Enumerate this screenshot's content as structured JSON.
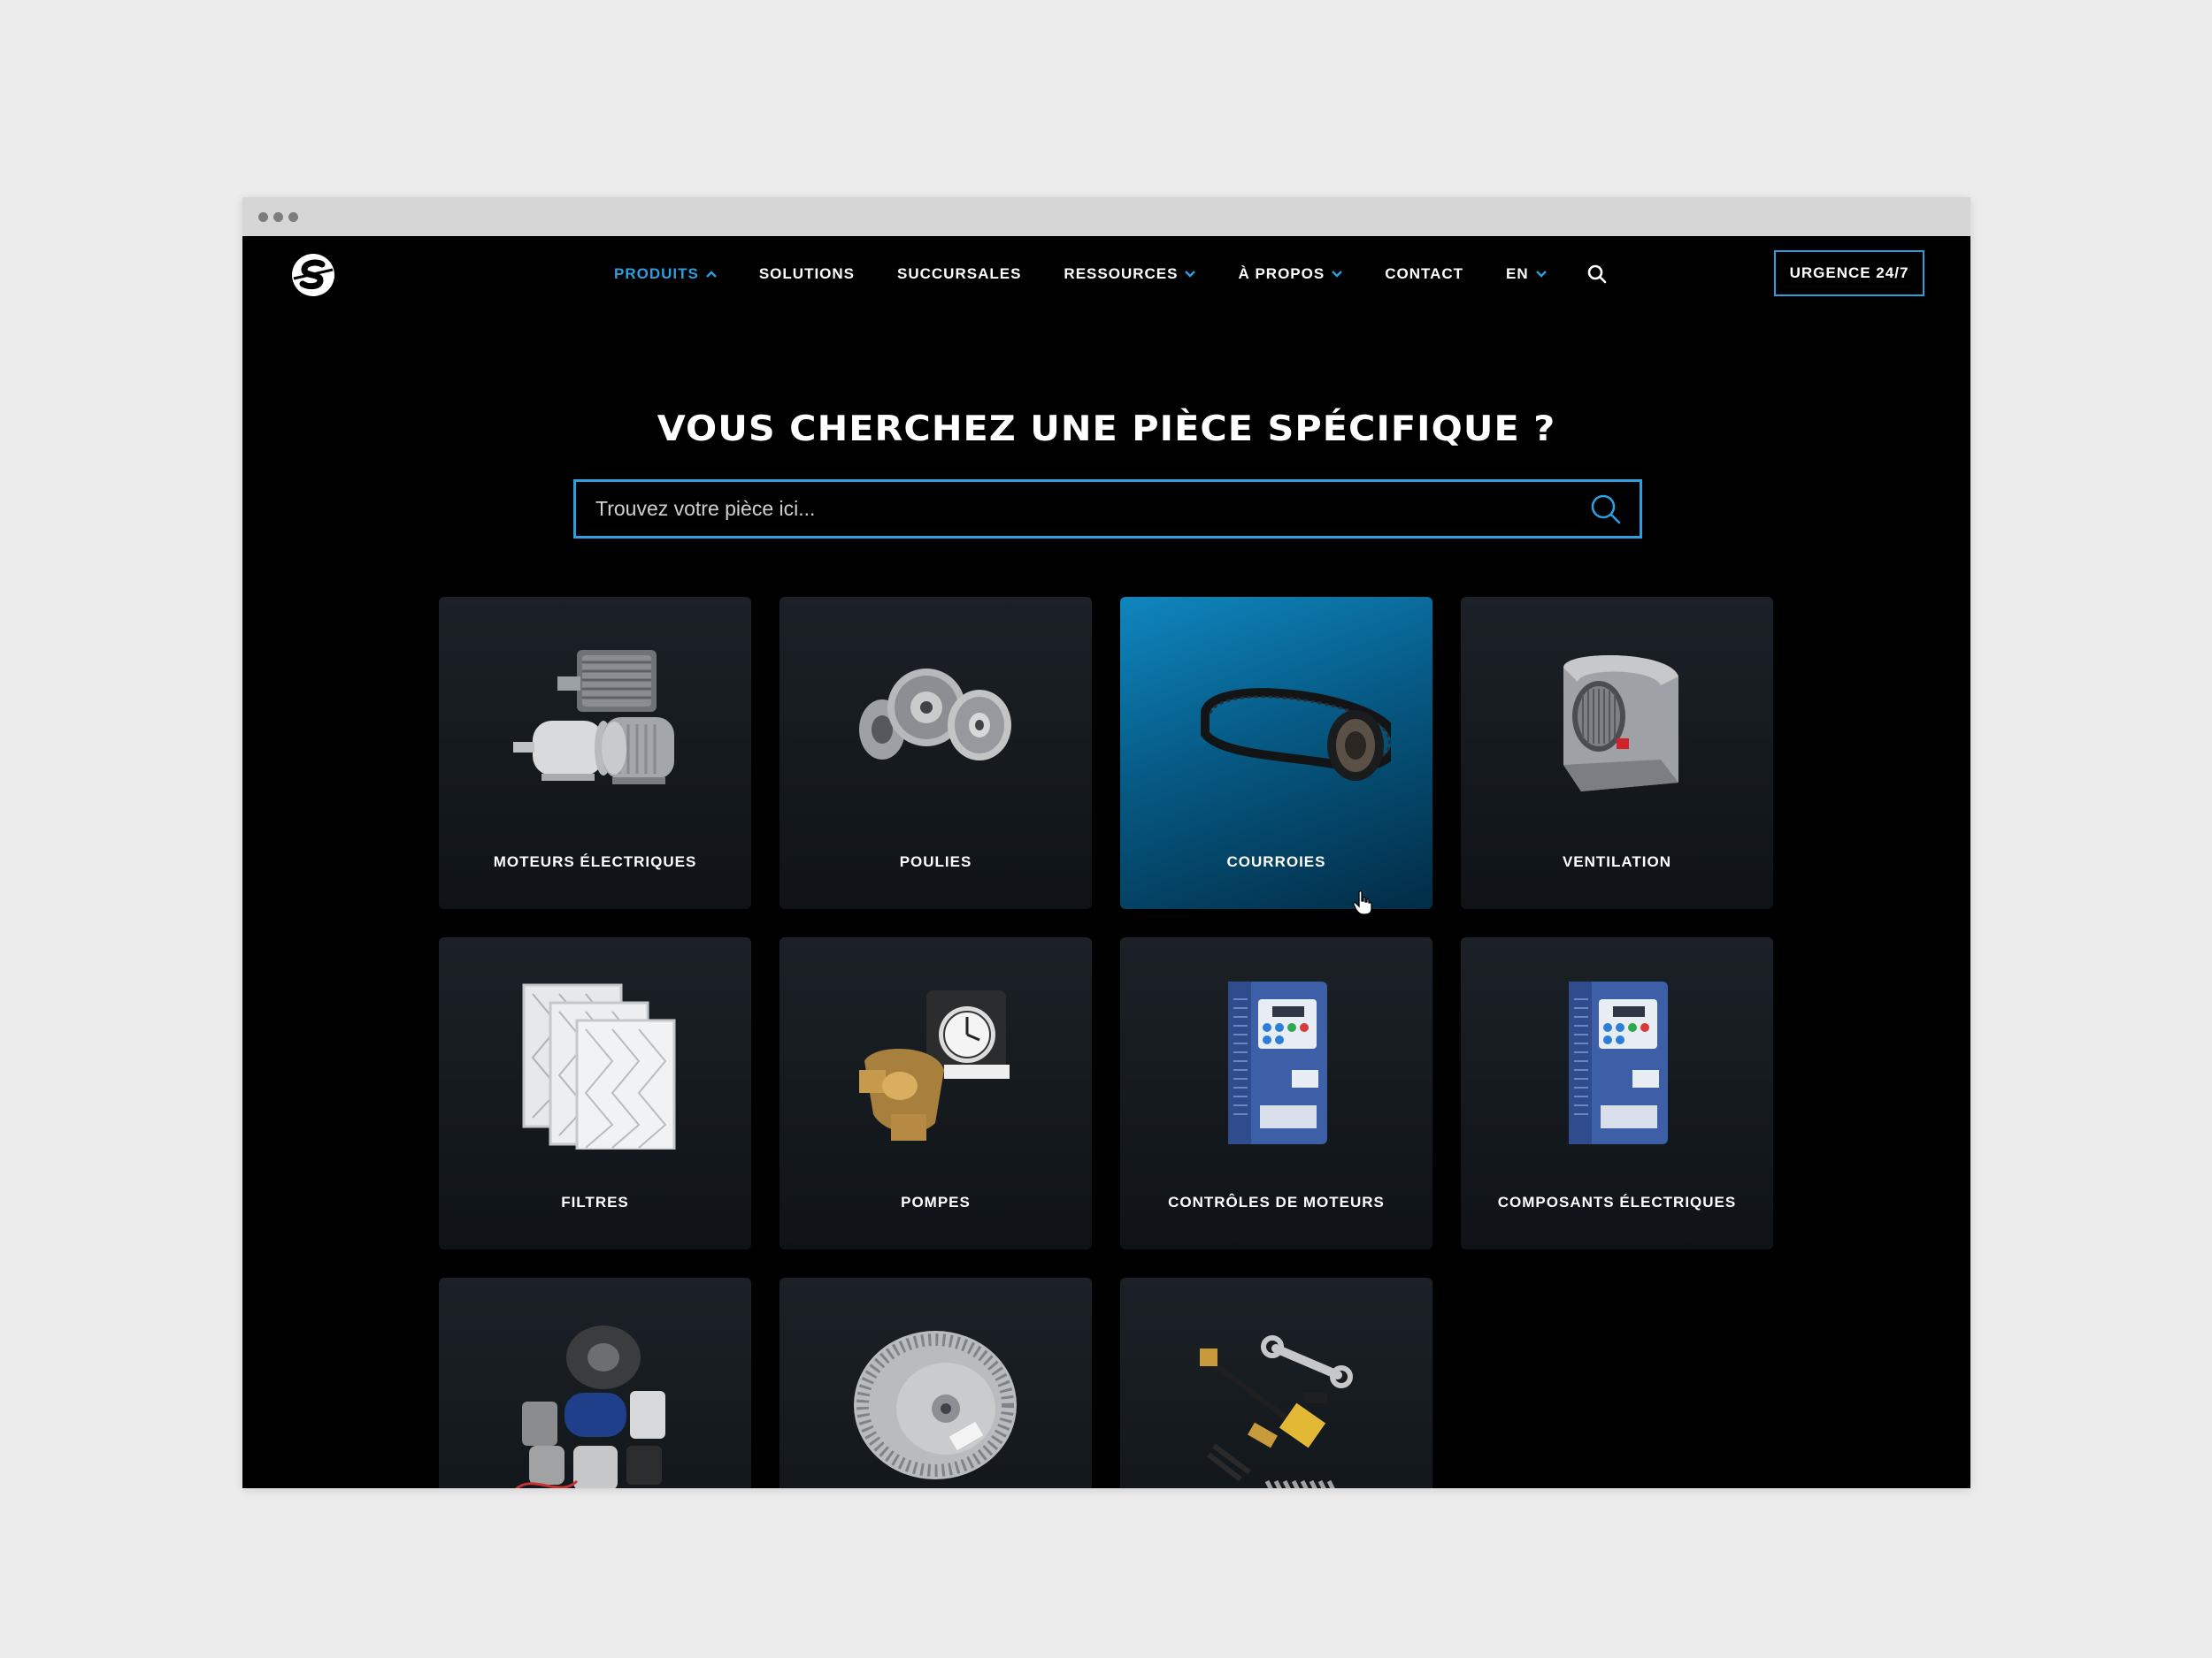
{
  "nav": {
    "items": [
      {
        "label": "PRODUITS",
        "active": true,
        "dropdown": "up"
      },
      {
        "label": "SOLUTIONS",
        "active": false,
        "dropdown": null
      },
      {
        "label": "SUCCURSALES",
        "active": false,
        "dropdown": null
      },
      {
        "label": "RESSOURCES",
        "active": false,
        "dropdown": "down"
      },
      {
        "label": "À PROPOS",
        "active": false,
        "dropdown": "down"
      },
      {
        "label": "CONTACT",
        "active": false,
        "dropdown": null
      },
      {
        "label": "EN",
        "active": false,
        "dropdown": "down"
      }
    ],
    "cta_label": "URGENCE 24/7"
  },
  "hero": {
    "title": "VOUS CHERCHEZ UNE PIÈCE SPÉCIFIQUE ?",
    "search_placeholder": "Trouvez votre pièce ici..."
  },
  "categories": [
    {
      "label": "MOTEURS ÉLECTRIQUES",
      "icon": "electric-motors-image"
    },
    {
      "label": "POULIES",
      "icon": "pulleys-image"
    },
    {
      "label": "COURROIES",
      "icon": "belts-image",
      "hover": true
    },
    {
      "label": "VENTILATION",
      "icon": "ventilation-image"
    },
    {
      "label": "FILTRES",
      "icon": "filters-image"
    },
    {
      "label": "POMPES",
      "icon": "pumps-image"
    },
    {
      "label": "CONTRÔLES DE MOTEURS",
      "icon": "motor-controls-image"
    },
    {
      "label": "COMPOSANTS ÉLECTRIQUES",
      "icon": "electrical-components-image"
    },
    {
      "label": "",
      "icon": "motor-capacitors-image"
    },
    {
      "label": "",
      "icon": "blower-wheel-image"
    },
    {
      "label": "",
      "icon": "tools-fittings-image"
    }
  ],
  "colors": {
    "accent": "#2b9fe0",
    "background": "#000000",
    "card": "#161b20"
  }
}
